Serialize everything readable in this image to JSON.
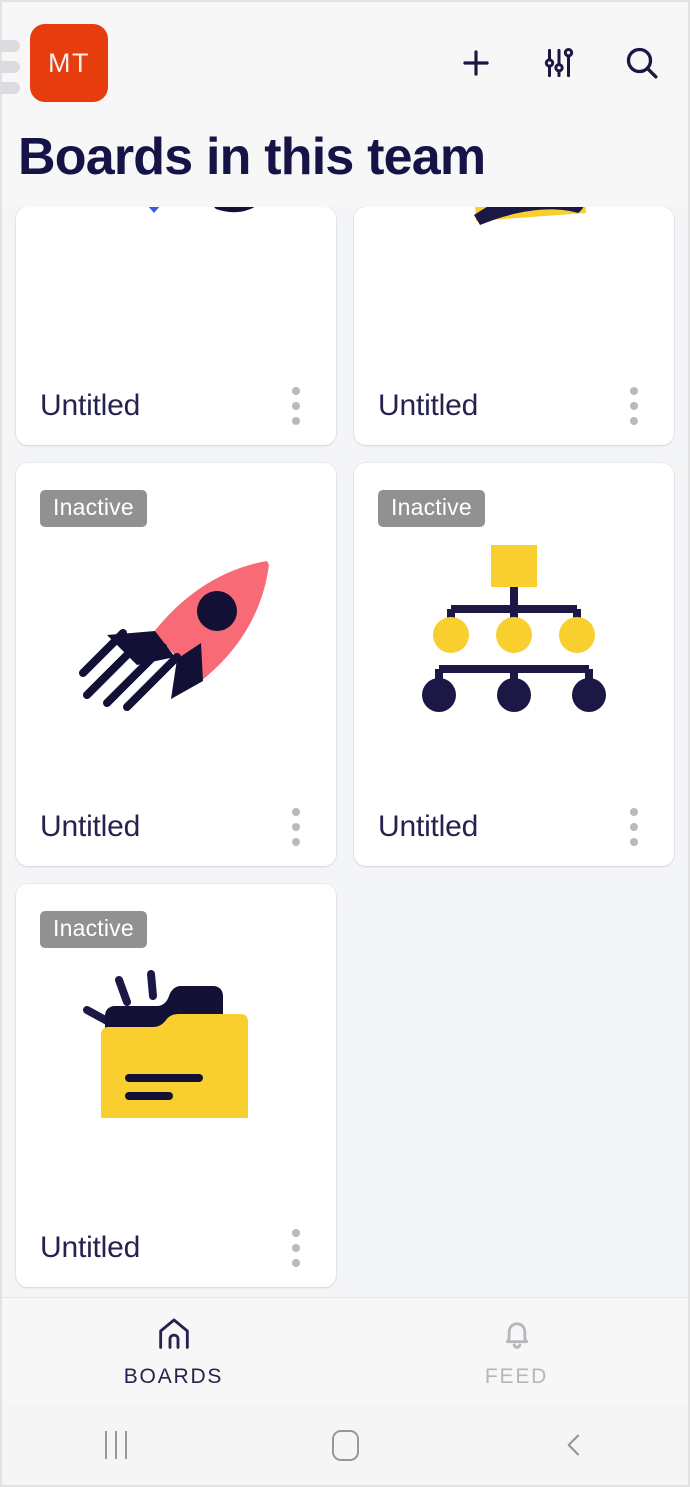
{
  "topbar": {
    "drawer_handle_icon": "drawer-handle-icon",
    "avatar_initials": "MT",
    "avatar_color": "#e73c0e",
    "actions": [
      {
        "name": "add-board-button",
        "icon": "plus-icon"
      },
      {
        "name": "filter-button",
        "icon": "sliders-icon"
      },
      {
        "name": "search-button",
        "icon": "search-icon"
      }
    ]
  },
  "page": {
    "title": "Boards in this team",
    "title_color": "#161347",
    "background_color": "#f4f5f6"
  },
  "boards": [
    {
      "title": "Untitled",
      "badge": null,
      "art": "sprout-and-arrow-illustration",
      "clipped": true,
      "menu_icon": "kebab-menu-icon"
    },
    {
      "title": "Untitled",
      "badge": null,
      "art": "yellow-note-illustration",
      "clipped": true,
      "menu_icon": "kebab-menu-icon"
    },
    {
      "title": "Untitled",
      "badge": "Inactive",
      "art": "rocket-illustration",
      "clipped": false,
      "menu_icon": "kebab-menu-icon"
    },
    {
      "title": "Untitled",
      "badge": "Inactive",
      "art": "org-chart-illustration",
      "clipped": false,
      "menu_icon": "kebab-menu-icon"
    },
    {
      "title": "Untitled",
      "badge": "Inactive",
      "art": "folder-illustration",
      "clipped": false,
      "menu_icon": "kebab-menu-icon"
    }
  ],
  "badge_color": "#919191",
  "tabbar": {
    "tabs": [
      {
        "label": "BOARDS",
        "icon": "home-icon",
        "active": true
      },
      {
        "label": "FEED",
        "icon": "bell-icon",
        "active": false
      }
    ]
  },
  "system_nav": {
    "recents_icon": "recents-icon",
    "home_icon": "home-square-icon",
    "back_icon": "back-chevron-icon"
  },
  "palette": {
    "navy": "#161347",
    "yellow": "#f8cf2e",
    "coral": "#f96a77",
    "blue": "#3b5bdb",
    "gray": "#919191"
  }
}
